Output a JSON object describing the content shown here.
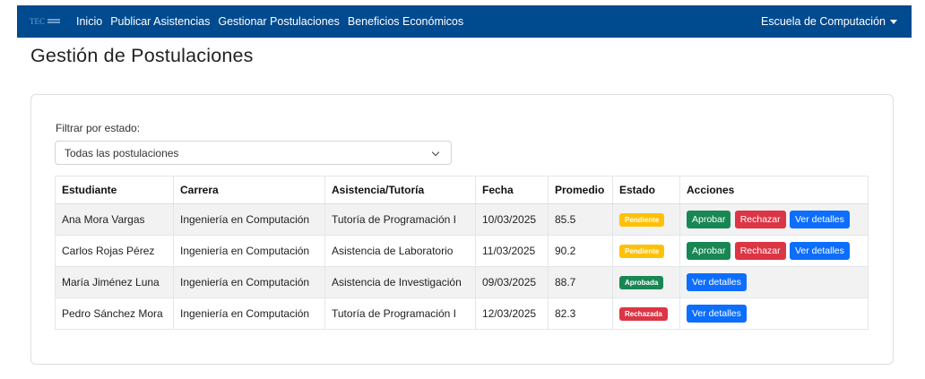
{
  "nav": {
    "brand": "TEC",
    "links": [
      "Inicio",
      "Publicar Asistencias",
      "Gestionar Postulaciones",
      "Beneficios Económicos"
    ],
    "school": "Escuela de Computación"
  },
  "page": {
    "title": "Gestión de Postulaciones"
  },
  "filter": {
    "label": "Filtrar por estado:",
    "selected": "Todas las postulaciones"
  },
  "table": {
    "headers": [
      "Estudiante",
      "Carrera",
      "Asistencia/Tutoría",
      "Fecha",
      "Promedio",
      "Estado",
      "Acciones"
    ],
    "rows": [
      {
        "student": "Ana Mora Vargas",
        "career": "Ingeniería en Computación",
        "assistance": "Tutoría de Programación I",
        "date": "10/03/2025",
        "avg": "85.5",
        "status": "Pendiente"
      },
      {
        "student": "Carlos Rojas Pérez",
        "career": "Ingeniería en Computación",
        "assistance": "Asistencia de Laboratorio",
        "date": "11/03/2025",
        "avg": "90.2",
        "status": "Pendiente"
      },
      {
        "student": "María Jiménez Luna",
        "career": "Ingeniería en Computación",
        "assistance": "Asistencia de Investigación",
        "date": "09/03/2025",
        "avg": "88.7",
        "status": "Aprobada"
      },
      {
        "student": "Pedro Sánchez Mora",
        "career": "Ingeniería en Computación",
        "assistance": "Tutoría de Programación I",
        "date": "12/03/2025",
        "avg": "82.3",
        "status": "Rechazada"
      }
    ]
  },
  "actions": {
    "approve": "Aprobar",
    "reject": "Rechazar",
    "details": "Ver detalles"
  },
  "colors": {
    "navbar": "#004a8f",
    "pending": "#ffc107",
    "approved": "#198754",
    "rejected": "#dc3545",
    "primary": "#0d6efd"
  }
}
